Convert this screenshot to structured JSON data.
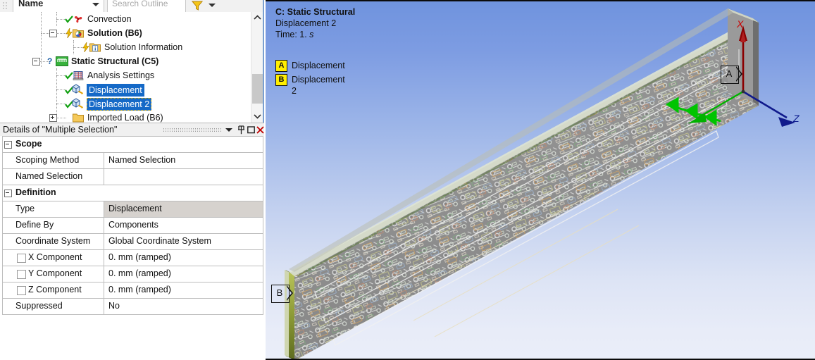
{
  "outline_toolbar": {
    "name_label": "Name",
    "search_placeholder": "Search Outline",
    "filter_icon": "filter-funnel-icon",
    "dropdown_icon": "chevron-down-icon"
  },
  "tree": {
    "items": [
      {
        "label": "Convection",
        "icon": "convection-icon",
        "bold": false,
        "selected": false,
        "indent": 3,
        "expander": "",
        "status": "check"
      },
      {
        "label": "Solution (B6)",
        "icon": "solution-folder-icon",
        "bold": true,
        "selected": false,
        "indent": 2,
        "expander": "minus",
        "status": "lightning"
      },
      {
        "label": "Solution Information",
        "icon": "information-folder-icon",
        "bold": false,
        "selected": false,
        "indent": 4,
        "expander": "",
        "status": "lightning"
      },
      {
        "label": "Static Structural (C5)",
        "icon": "static-structural-icon",
        "bold": true,
        "selected": false,
        "indent": 1,
        "expander": "minus",
        "status": "question"
      },
      {
        "label": "Analysis Settings",
        "icon": "analysis-settings-icon",
        "bold": false,
        "selected": false,
        "indent": 3,
        "expander": "",
        "status": "check"
      },
      {
        "label": "Displacement",
        "icon": "displacement-icon",
        "bold": false,
        "selected": true,
        "indent": 3,
        "expander": "",
        "status": "check"
      },
      {
        "label": "Displacement 2",
        "icon": "displacement-icon",
        "bold": false,
        "selected": true,
        "indent": 3,
        "expander": "",
        "status": "check",
        "focused": true
      },
      {
        "label": "Imported Load (B6)",
        "icon": "imported-load-icon",
        "bold": false,
        "selected": false,
        "indent": 2,
        "expander": "plus",
        "status": "check"
      }
    ],
    "scrollbar": {
      "up_icon": "chevron-up-icon",
      "down_icon": "chevron-down-icon"
    }
  },
  "details": {
    "title": "Details of \"Multiple Selection\"",
    "window_buttons": {
      "dropdown": "chevron-down-icon",
      "pin": "pin-icon",
      "maximize": "maximize-icon",
      "close": "close-icon"
    },
    "rows": [
      {
        "kind": "header",
        "label": "Scope",
        "value": ""
      },
      {
        "kind": "property",
        "label": "Scoping Method",
        "value": "Named Selection"
      },
      {
        "kind": "property",
        "label": "Named Selection",
        "value": ""
      },
      {
        "kind": "header",
        "label": "Definition",
        "value": ""
      },
      {
        "kind": "property",
        "label": "Type",
        "value": "Displacement",
        "shaded": true
      },
      {
        "kind": "property",
        "label": "Define By",
        "value": "Components"
      },
      {
        "kind": "property",
        "label": "Coordinate System",
        "value": "Global Coordinate System"
      },
      {
        "kind": "checkbox",
        "label": "X Component",
        "value": "0. mm  (ramped)",
        "checked": false
      },
      {
        "kind": "checkbox",
        "label": "Y Component",
        "value": "0. mm  (ramped)",
        "checked": false
      },
      {
        "kind": "checkbox",
        "label": "Z Component",
        "value": "0. mm  (ramped)",
        "checked": false
      },
      {
        "kind": "property",
        "label": "Suppressed",
        "value": "No"
      }
    ]
  },
  "viewport": {
    "title": "C: Static Structural",
    "subtitle": "Displacement 2",
    "time_label": "Time: 1.",
    "time_unit": "s",
    "legend": [
      {
        "key": "A",
        "label": "Displacement"
      },
      {
        "key": "B",
        "label": "Displacement 2"
      }
    ],
    "callouts": [
      {
        "key": "A"
      },
      {
        "key": "B"
      }
    ],
    "triad": {
      "x_label": "X",
      "z_label": "Z",
      "x_color": "#cc0000",
      "y_color": "#00bb00",
      "z_color": "#0d1c8f"
    },
    "colors": {
      "background_top": "#6f93de",
      "background_bottom": "#eaeef9",
      "board_face": "#8d8d8d",
      "board_edge": "#8e9a3c",
      "support_green": "#00c000",
      "annotation_yellow": "#ffee00"
    }
  }
}
